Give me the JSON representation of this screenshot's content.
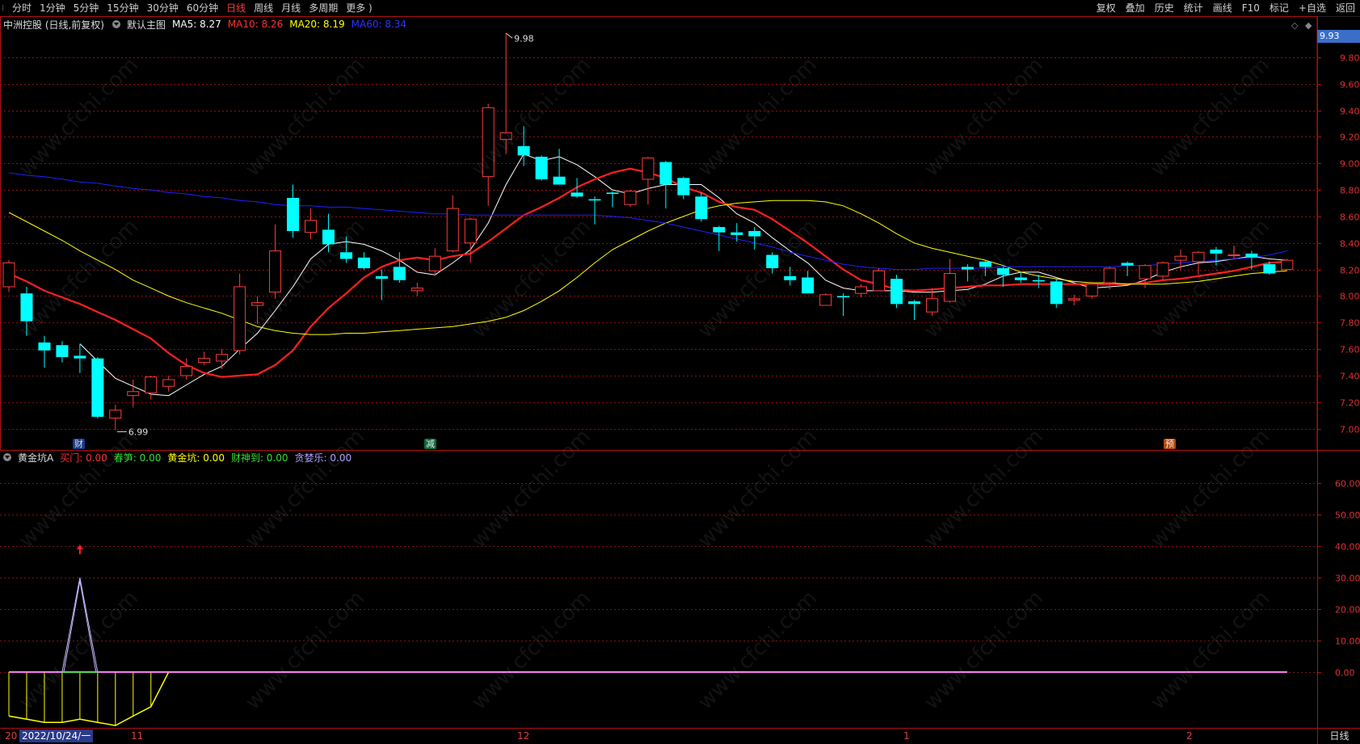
{
  "toolbar": {
    "periods": [
      "分时",
      "1分钟",
      "5分钟",
      "15分钟",
      "30分钟",
      "60分钟",
      "日线",
      "周线",
      "月线",
      "多周期",
      "更多 )"
    ],
    "active_index": 6,
    "right": [
      "复权",
      "叠加",
      "历史",
      "统计",
      "画线",
      "F10",
      "标记",
      "+自选",
      "返回"
    ]
  },
  "main_info": {
    "title": "中洲控股 (日线,前复权)",
    "template": "默认主图",
    "ma5": "MA5: 8.27",
    "ma10": "MA10: 8.26",
    "ma20": "MA20: 8.19",
    "ma60": "MA60: 8.34"
  },
  "sub_info": {
    "title": "黄金坑A",
    "items": [
      "买门: 0.00",
      "春笋: 0.00",
      "黄金坑: 0.00",
      "财神到: 0.00",
      "贪婪乐: 0.00"
    ]
  },
  "colors": {
    "up": "#ff3b3b",
    "down": "#00ffff",
    "ma5": "#ffffff",
    "ma10": "#ff2020",
    "ma20": "#ffff00",
    "ma60": "#2020ff",
    "grid": "#8a1010"
  },
  "markers": {
    "cai": "财",
    "jian": "减",
    "yu": "预"
  },
  "bottom": {
    "date_box": "2022/10/24/一",
    "prefix": "20",
    "months": [
      "11",
      "12",
      "1",
      "2"
    ],
    "period": "日线"
  },
  "watermark": "www.cfchi.com",
  "chart_data": [
    {
      "type": "candlestick",
      "title": "中洲控股 (日线,前复权)",
      "y_ticks": [
        "9.80",
        "9.60",
        "9.40",
        "9.20",
        "9.00",
        "8.80",
        "8.60",
        "8.40",
        "8.20",
        "8.00",
        "7.80",
        "7.60",
        "7.40",
        "7.20",
        "7.00"
      ],
      "ylim": [
        6.84,
        10.0
      ],
      "last_price": "9.93",
      "annotations": [
        {
          "text": "9.98",
          "type": "high"
        },
        {
          "text": "6.99",
          "type": "low"
        }
      ],
      "candles": [
        {
          "o": 8.07,
          "c": 8.25,
          "h": 8.27,
          "l": 8.03
        },
        {
          "o": 8.02,
          "c": 7.81,
          "h": 8.07,
          "l": 7.7
        },
        {
          "o": 7.65,
          "c": 7.59,
          "h": 7.7,
          "l": 7.46
        },
        {
          "o": 7.63,
          "c": 7.54,
          "h": 7.66,
          "l": 7.5
        },
        {
          "o": 7.55,
          "c": 7.53,
          "h": 7.64,
          "l": 7.42
        },
        {
          "o": 7.53,
          "c": 7.09,
          "h": 7.54,
          "l": 7.08
        },
        {
          "o": 7.08,
          "c": 7.14,
          "h": 7.18,
          "l": 6.99
        },
        {
          "o": 7.25,
          "c": 7.28,
          "h": 7.37,
          "l": 7.16
        },
        {
          "o": 7.27,
          "c": 7.39,
          "h": 7.4,
          "l": 7.22
        },
        {
          "o": 7.32,
          "c": 7.37,
          "h": 7.4,
          "l": 7.28
        },
        {
          "o": 7.4,
          "c": 7.47,
          "h": 7.53,
          "l": 7.37
        },
        {
          "o": 7.5,
          "c": 7.53,
          "h": 7.58,
          "l": 7.48
        },
        {
          "o": 7.51,
          "c": 7.56,
          "h": 7.6,
          "l": 7.45
        },
        {
          "o": 7.59,
          "c": 8.07,
          "h": 8.17,
          "l": 7.56
        },
        {
          "o": 7.93,
          "c": 7.95,
          "h": 8.0,
          "l": 7.79
        },
        {
          "o": 8.03,
          "c": 8.34,
          "h": 8.54,
          "l": 7.98
        },
        {
          "o": 8.74,
          "c": 8.49,
          "h": 8.84,
          "l": 8.44
        },
        {
          "o": 8.48,
          "c": 8.57,
          "h": 8.66,
          "l": 8.43
        },
        {
          "o": 8.5,
          "c": 8.39,
          "h": 8.62,
          "l": 8.33
        },
        {
          "o": 8.33,
          "c": 8.28,
          "h": 8.45,
          "l": 8.25
        },
        {
          "o": 8.29,
          "c": 8.21,
          "h": 8.33,
          "l": 8.2
        },
        {
          "o": 8.15,
          "c": 8.13,
          "h": 8.2,
          "l": 7.97
        },
        {
          "o": 8.22,
          "c": 8.12,
          "h": 8.33,
          "l": 8.1
        },
        {
          "o": 8.04,
          "c": 8.06,
          "h": 8.1,
          "l": 8.0
        },
        {
          "o": 8.19,
          "c": 8.3,
          "h": 8.36,
          "l": 8.16
        },
        {
          "o": 8.34,
          "c": 8.66,
          "h": 8.76,
          "l": 8.33
        },
        {
          "o": 8.4,
          "c": 8.58,
          "h": 8.59,
          "l": 8.25
        },
        {
          "o": 8.9,
          "c": 9.42,
          "h": 9.45,
          "l": 8.68
        },
        {
          "o": 9.18,
          "c": 9.23,
          "h": 9.98,
          "l": 9.07
        },
        {
          "o": 9.13,
          "c": 9.06,
          "h": 9.28,
          "l": 8.98
        },
        {
          "o": 9.05,
          "c": 8.88,
          "h": 9.06,
          "l": 8.87
        },
        {
          "o": 8.9,
          "c": 8.84,
          "h": 9.11,
          "l": 8.88
        },
        {
          "o": 8.78,
          "c": 8.75,
          "h": 8.89,
          "l": 8.74
        },
        {
          "o": 8.73,
          "c": 8.72,
          "h": 8.75,
          "l": 8.54
        },
        {
          "o": 8.78,
          "c": 8.77,
          "h": 8.79,
          "l": 8.67
        },
        {
          "o": 8.69,
          "c": 8.79,
          "h": 8.8,
          "l": 8.67
        },
        {
          "o": 8.88,
          "c": 9.04,
          "h": 9.05,
          "l": 8.69
        },
        {
          "o": 9.01,
          "c": 8.84,
          "h": 9.02,
          "l": 8.66
        },
        {
          "o": 8.89,
          "c": 8.76,
          "h": 8.9,
          "l": 8.73
        },
        {
          "o": 8.75,
          "c": 8.58,
          "h": 8.78,
          "l": 8.56
        },
        {
          "o": 8.52,
          "c": 8.48,
          "h": 8.53,
          "l": 8.34
        },
        {
          "o": 8.48,
          "c": 8.46,
          "h": 8.55,
          "l": 8.41
        },
        {
          "o": 8.49,
          "c": 8.45,
          "h": 8.52,
          "l": 8.35
        },
        {
          "o": 8.31,
          "c": 8.21,
          "h": 8.33,
          "l": 8.17
        },
        {
          "o": 8.15,
          "c": 8.12,
          "h": 8.22,
          "l": 8.08
        },
        {
          "o": 8.14,
          "c": 8.02,
          "h": 8.19,
          "l": 8.03
        },
        {
          "o": 7.93,
          "c": 8.01,
          "h": 8.02,
          "l": 7.93
        },
        {
          "o": 8.0,
          "c": 7.99,
          "h": 8.02,
          "l": 7.85
        },
        {
          "o": 8.02,
          "c": 8.07,
          "h": 8.09,
          "l": 7.99
        },
        {
          "o": 8.04,
          "c": 8.19,
          "h": 8.21,
          "l": 8.04
        },
        {
          "o": 8.13,
          "c": 7.94,
          "h": 8.16,
          "l": 7.91
        },
        {
          "o": 7.96,
          "c": 7.94,
          "h": 7.97,
          "l": 7.82
        },
        {
          "o": 7.88,
          "c": 7.98,
          "h": 8.06,
          "l": 7.85
        },
        {
          "o": 7.96,
          "c": 8.17,
          "h": 8.28,
          "l": 7.95
        },
        {
          "o": 8.22,
          "c": 8.2,
          "h": 8.24,
          "l": 8.11
        },
        {
          "o": 8.26,
          "c": 8.22,
          "h": 8.27,
          "l": 8.15
        },
        {
          "o": 8.21,
          "c": 8.16,
          "h": 8.22,
          "l": 8.07
        },
        {
          "o": 8.14,
          "c": 8.12,
          "h": 8.18,
          "l": 8.1
        },
        {
          "o": 8.12,
          "c": 8.11,
          "h": 8.16,
          "l": 8.06
        },
        {
          "o": 8.11,
          "c": 7.94,
          "h": 8.13,
          "l": 7.91
        },
        {
          "o": 7.97,
          "c": 7.98,
          "h": 8.01,
          "l": 7.93
        },
        {
          "o": 8.0,
          "c": 8.09,
          "h": 8.11,
          "l": 7.98
        },
        {
          "o": 8.1,
          "c": 8.21,
          "h": 8.22,
          "l": 8.05
        },
        {
          "o": 8.25,
          "c": 8.23,
          "h": 8.26,
          "l": 8.15
        },
        {
          "o": 8.13,
          "c": 8.23,
          "h": 8.24,
          "l": 8.06
        },
        {
          "o": 8.15,
          "c": 8.25,
          "h": 8.26,
          "l": 8.12
        },
        {
          "o": 8.27,
          "c": 8.3,
          "h": 8.35,
          "l": 8.2
        },
        {
          "o": 8.26,
          "c": 8.33,
          "h": 8.34,
          "l": 8.16
        },
        {
          "o": 8.35,
          "c": 8.32,
          "h": 8.37,
          "l": 8.23
        },
        {
          "o": 8.31,
          "c": 8.31,
          "h": 8.38,
          "l": 8.28
        },
        {
          "o": 8.32,
          "c": 8.29,
          "h": 8.34,
          "l": 8.2
        },
        {
          "o": 8.24,
          "c": 8.17,
          "h": 8.26,
          "l": 8.16
        },
        {
          "o": 8.2,
          "c": 8.27,
          "h": 8.28,
          "l": 8.19
        }
      ],
      "series": [
        {
          "name": "MA5",
          "values": [
            null,
            null,
            null,
            null,
            7.64,
            7.51,
            7.38,
            7.32,
            7.26,
            7.25,
            7.33,
            7.41,
            7.47,
            7.6,
            7.72,
            7.89,
            8.07,
            8.28,
            8.39,
            8.41,
            8.39,
            8.34,
            8.27,
            8.18,
            8.16,
            8.25,
            8.35,
            8.55,
            8.84,
            9.07,
            9.02,
            9.05,
            8.99,
            8.9,
            8.8,
            8.77,
            8.81,
            8.84,
            8.84,
            8.84,
            8.74,
            8.62,
            8.55,
            8.44,
            8.34,
            8.25,
            8.12,
            8.06,
            8.04,
            8.04,
            8.04,
            8.03,
            8.03,
            8.04,
            8.05,
            8.09,
            8.15,
            8.18,
            8.18,
            8.14,
            8.1,
            8.06,
            8.07,
            8.08,
            8.12,
            8.18,
            8.22,
            8.25,
            8.26,
            8.28,
            8.3,
            8.28,
            8.27
          ]
        },
        {
          "name": "MA10",
          "values": [
            8.17,
            8.11,
            8.04,
            7.99,
            7.94,
            7.88,
            7.82,
            7.75,
            7.68,
            7.57,
            7.48,
            7.42,
            7.39,
            7.4,
            7.41,
            7.48,
            7.59,
            7.77,
            7.91,
            8.02,
            8.14,
            8.22,
            8.27,
            8.29,
            8.27,
            8.3,
            8.32,
            8.41,
            8.51,
            8.61,
            8.67,
            8.74,
            8.82,
            8.88,
            8.93,
            8.96,
            8.93,
            8.89,
            8.82,
            8.78,
            8.71,
            8.67,
            8.65,
            8.58,
            8.49,
            8.4,
            8.3,
            8.2,
            8.12,
            8.09,
            8.05,
            8.04,
            8.05,
            8.06,
            8.07,
            8.08,
            8.08,
            8.09,
            8.09,
            8.09,
            8.09,
            8.09,
            8.09,
            8.09,
            8.1,
            8.12,
            8.13,
            8.15,
            8.17,
            8.19,
            8.22,
            8.25,
            8.26
          ]
        },
        {
          "name": "MA20",
          "values": [
            8.63,
            8.56,
            8.49,
            8.42,
            8.34,
            8.27,
            8.2,
            8.12,
            8.06,
            8.0,
            7.95,
            7.91,
            7.87,
            7.82,
            7.77,
            7.74,
            7.72,
            7.71,
            7.71,
            7.72,
            7.72,
            7.73,
            7.74,
            7.75,
            7.76,
            7.77,
            7.79,
            7.81,
            7.84,
            7.89,
            7.96,
            8.04,
            8.14,
            8.25,
            8.35,
            8.42,
            8.49,
            8.55,
            8.6,
            8.65,
            8.68,
            8.7,
            8.71,
            8.72,
            8.72,
            8.72,
            8.71,
            8.68,
            8.62,
            8.55,
            8.47,
            8.4,
            8.36,
            8.33,
            8.3,
            8.27,
            8.23,
            8.18,
            8.15,
            8.13,
            8.11,
            8.1,
            8.1,
            8.09,
            8.09,
            8.09,
            8.1,
            8.11,
            8.13,
            8.15,
            8.17,
            8.18,
            8.19
          ]
        },
        {
          "name": "MA60",
          "values": [
            8.93,
            8.91,
            8.9,
            8.88,
            8.86,
            8.85,
            8.83,
            8.81,
            8.8,
            8.78,
            8.77,
            8.75,
            8.74,
            8.72,
            8.71,
            8.69,
            8.68,
            8.68,
            8.67,
            8.67,
            8.66,
            8.65,
            8.64,
            8.63,
            8.62,
            8.62,
            8.61,
            8.61,
            8.61,
            8.61,
            8.61,
            8.61,
            8.61,
            8.61,
            8.6,
            8.59,
            8.57,
            8.55,
            8.52,
            8.49,
            8.46,
            8.43,
            8.4,
            8.37,
            8.33,
            8.3,
            8.27,
            8.24,
            8.22,
            8.21,
            8.2,
            8.2,
            8.21,
            8.21,
            8.21,
            8.21,
            8.22,
            8.22,
            8.22,
            8.22,
            8.22,
            8.22,
            8.22,
            8.23,
            8.23,
            8.24,
            8.25,
            8.26,
            8.27,
            8.28,
            8.29,
            8.31,
            8.34
          ]
        }
      ]
    },
    {
      "type": "line",
      "title": "黄金坑A",
      "y_ticks": [
        "60.00",
        "50.00",
        "40.00",
        "30.00",
        "20.00",
        "10.00",
        "0.00"
      ],
      "ylim": [
        -18,
        66
      ],
      "series": [
        {
          "name": "黄金坑A",
          "values": [
            -14,
            -15,
            -16,
            -16,
            -15,
            -16,
            -17,
            -14,
            -11,
            0,
            0,
            0,
            0,
            0,
            0,
            0,
            0,
            0,
            0,
            0,
            0,
            0,
            0,
            0,
            0,
            0,
            0,
            0,
            0,
            0,
            0,
            0,
            0,
            0,
            0,
            0,
            0,
            0,
            0,
            0,
            0,
            0,
            0,
            0,
            0,
            0,
            0,
            0,
            0,
            0,
            0,
            0,
            0,
            0,
            0,
            0,
            0,
            0,
            0,
            0,
            0,
            0,
            0,
            0,
            0,
            0,
            0,
            0,
            0,
            0,
            0,
            0,
            0
          ]
        },
        {
          "name": "spike",
          "values": [
            0,
            0,
            0,
            0,
            30,
            0,
            0
          ]
        }
      ]
    }
  ]
}
